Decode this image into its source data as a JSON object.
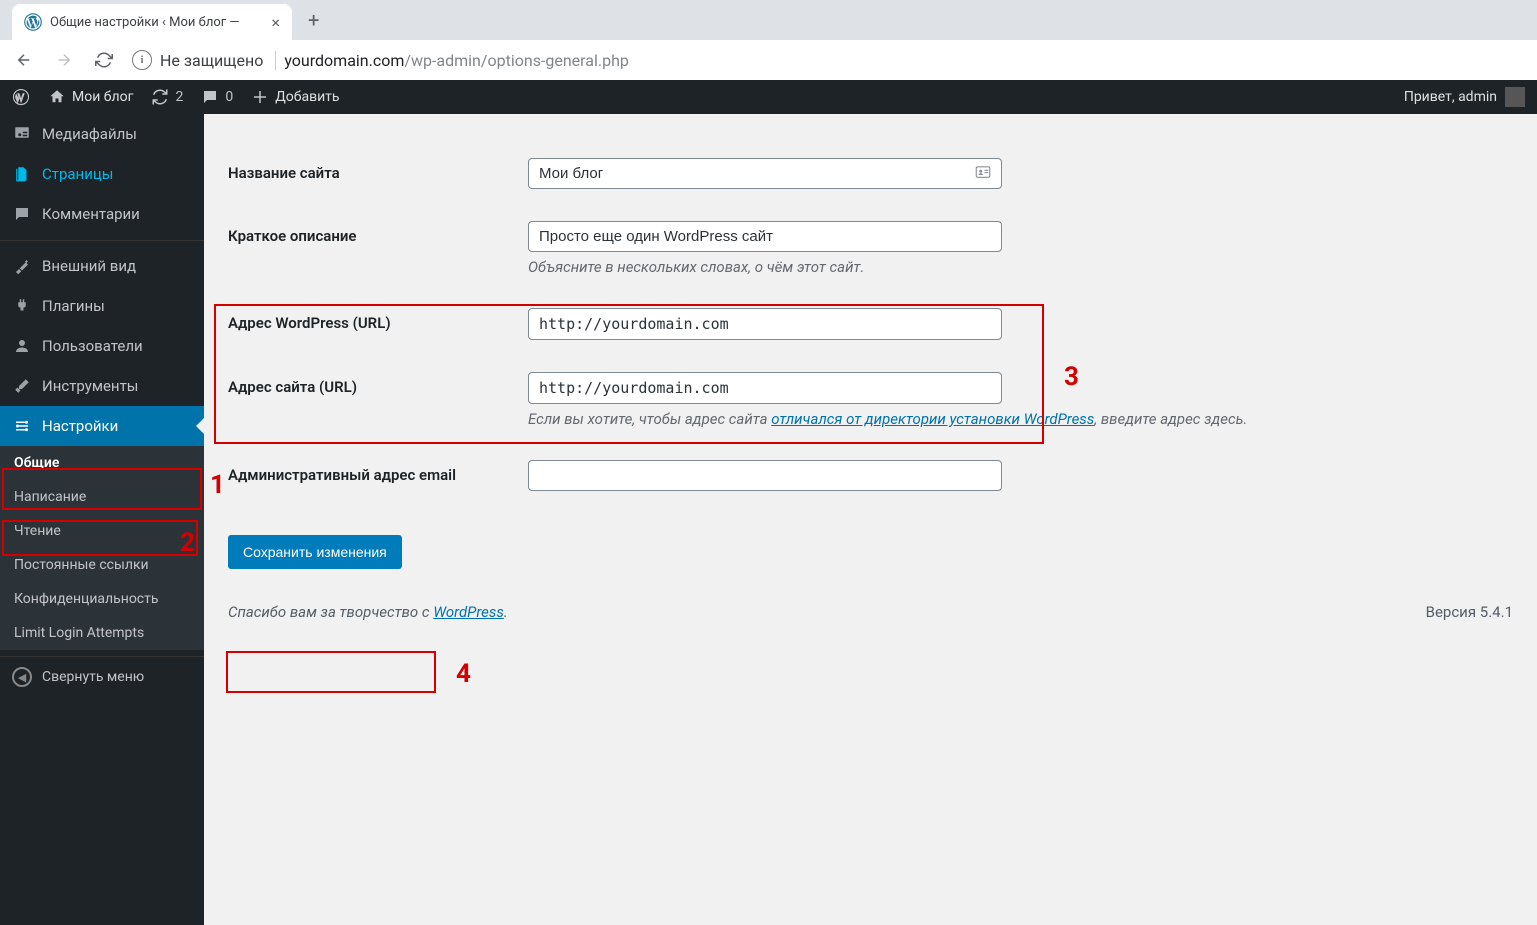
{
  "browser": {
    "tab_title": "Общие настройки ‹ Мои блог —",
    "security_label": "Не защищено",
    "url_domain": "yourdomain.com",
    "url_path": "/wp-admin/options-general.php"
  },
  "adminbar": {
    "site_name": "Мои блог",
    "updates_count": "2",
    "comments_count": "0",
    "add_new": "Добавить",
    "greeting": "Привет, admin"
  },
  "sidebar": {
    "media": "Медиафайлы",
    "pages": "Страницы",
    "comments": "Комментарии",
    "appearance": "Внешний вид",
    "plugins": "Плагины",
    "users": "Пользователи",
    "tools": "Инструменты",
    "settings": "Настройки",
    "submenu": {
      "general": "Общие",
      "writing": "Написание",
      "reading": "Чтение",
      "permalinks": "Постоянные ссылки",
      "privacy": "Конфиденциальность",
      "limit_login": "Limit Login Attempts"
    },
    "collapse": "Свернуть меню"
  },
  "form": {
    "blogname_label": "Название сайта",
    "blogname_value": "Мои блог",
    "tagline_label": "Краткое описание",
    "tagline_value": "Просто еще один WordPress сайт",
    "tagline_desc": "Объясните в нескольких словах, о чём этот сайт.",
    "wpurl_label": "Адрес WordPress (URL)",
    "wpurl_value": "http://yourdomain.com",
    "siteurl_label": "Адрес сайта (URL)",
    "siteurl_value": "http://yourdomain.com",
    "siteurl_desc_prefix": "Если вы хотите, чтобы адрес сайта ",
    "siteurl_desc_link": "отличался от директории установки WordPress",
    "siteurl_desc_suffix": ", введите адрес здесь.",
    "admin_email_label": "Административный адрес email",
    "admin_email_value": "",
    "submit_label": "Сохранить изменения"
  },
  "footer": {
    "thanks_prefix": "Спасибо вам за творчество с ",
    "thanks_link": "WordPress",
    "thanks_suffix": ".",
    "version": "Версия 5.4.1"
  },
  "annotations": {
    "n1": "1",
    "n2": "2",
    "n3": "3",
    "n4": "4"
  }
}
